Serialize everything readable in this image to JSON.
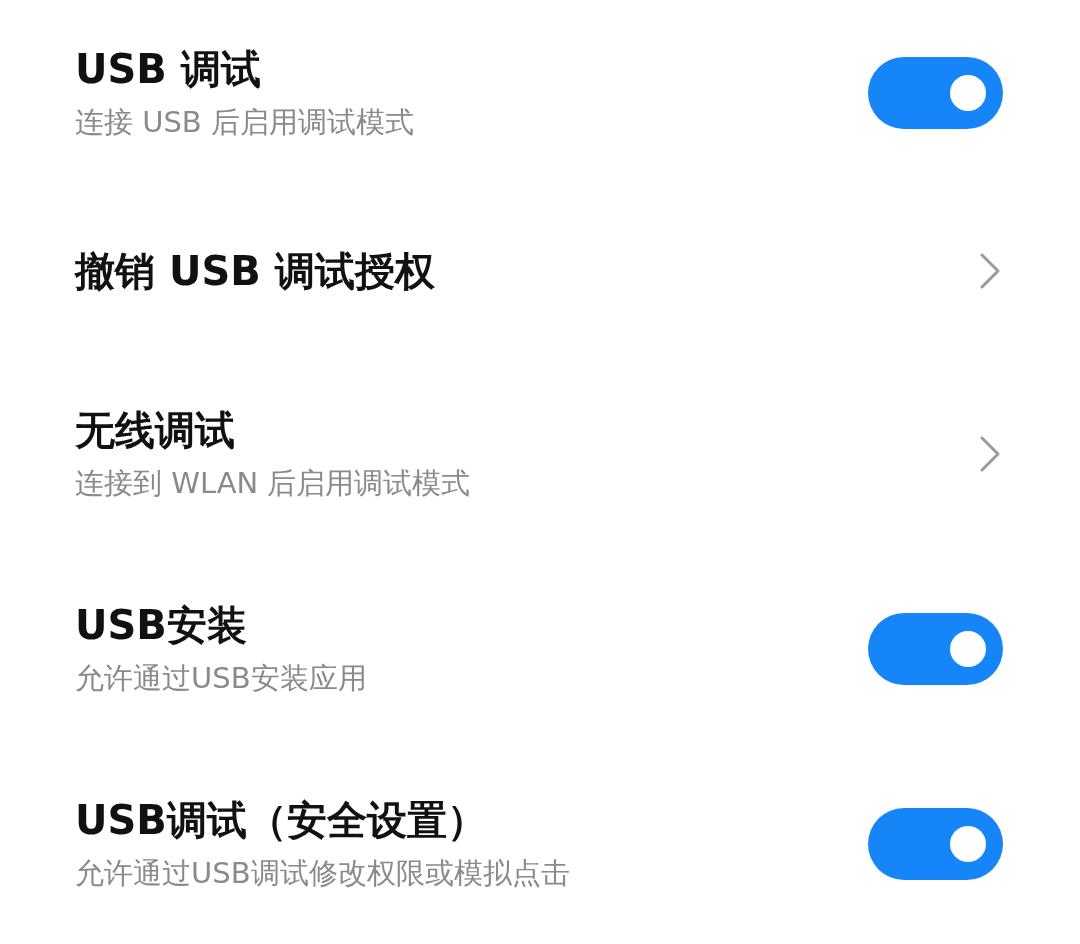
{
  "settings": [
    {
      "kind": "toggle",
      "title": "USB 调试",
      "subtitle": "连接 USB 后启用调试模式",
      "on": true
    },
    {
      "kind": "link",
      "title": "撤销 USB 调试授权"
    },
    {
      "kind": "link",
      "title": "无线调试",
      "subtitle": "连接到 WLAN 后启用调试模式"
    },
    {
      "kind": "toggle",
      "title": "USB安装",
      "subtitle": "允许通过USB安装应用",
      "on": true
    },
    {
      "kind": "toggle",
      "title": "USB调试（安全设置）",
      "subtitle": "允许通过USB调试修改权限或模拟点击",
      "on": true
    }
  ]
}
